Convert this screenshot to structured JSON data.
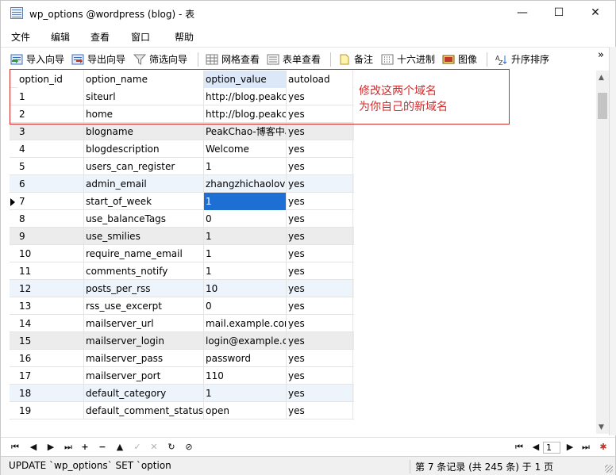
{
  "window": {
    "title": "wp_options @wordpress (blog) - 表",
    "minimize": "—",
    "maximize": "☐",
    "close": "✕"
  },
  "menu": [
    "文件",
    "编辑",
    "查看",
    "窗口",
    "帮助"
  ],
  "toolbar": {
    "import": "导入向导",
    "export": "导出向导",
    "filter": "筛选向导",
    "grid_view": "网格查看",
    "form_view": "表单查看",
    "memo": "备注",
    "hex": "十六进制",
    "image": "图像",
    "sort": "升序排序",
    "more": "»"
  },
  "grid": {
    "columns": [
      "option_id",
      "option_name",
      "option_value",
      "autoload"
    ],
    "rows": [
      [
        "1",
        "siteurl",
        "http://blog.peakchao.com",
        "yes"
      ],
      [
        "2",
        "home",
        "http://blog.peakchao.com",
        "yes"
      ],
      [
        "3",
        "blogname",
        "PeakChao-博客中心",
        "yes"
      ],
      [
        "4",
        "blogdescription",
        "Welcome",
        "yes"
      ],
      [
        "5",
        "users_can_register",
        "1",
        "yes"
      ],
      [
        "6",
        "admin_email",
        "zhangzhichaolove@gmail.com",
        "yes"
      ],
      [
        "7",
        "start_of_week",
        "1",
        "yes"
      ],
      [
        "8",
        "use_balanceTags",
        "0",
        "yes"
      ],
      [
        "9",
        "use_smilies",
        "1",
        "yes"
      ],
      [
        "10",
        "require_name_email",
        "1",
        "yes"
      ],
      [
        "11",
        "comments_notify",
        "1",
        "yes"
      ],
      [
        "12",
        "posts_per_rss",
        "10",
        "yes"
      ],
      [
        "13",
        "rss_use_excerpt",
        "0",
        "yes"
      ],
      [
        "14",
        "mailserver_url",
        "mail.example.com",
        "yes"
      ],
      [
        "15",
        "mailserver_login",
        "login@example.com",
        "yes"
      ],
      [
        "16",
        "mailserver_pass",
        "password",
        "yes"
      ],
      [
        "17",
        "mailserver_port",
        "110",
        "yes"
      ],
      [
        "18",
        "default_category",
        "1",
        "yes"
      ],
      [
        "19",
        "default_comment_status",
        "open",
        "yes"
      ]
    ],
    "current_row": "7"
  },
  "annotation": {
    "line1": "修改这两个域名",
    "line2": "为你自己的新域名"
  },
  "navigation": {
    "page": "1"
  },
  "status": {
    "sql": "UPDATE `wp_options` SET `option",
    "record": "第 7 条记录 (共 245 条) 于 1 页"
  },
  "colors": {
    "selection": "#1e6fd4",
    "annotation": "#d42a2a",
    "alt_row": "#ececec",
    "blue_row": "#eef4fc"
  }
}
